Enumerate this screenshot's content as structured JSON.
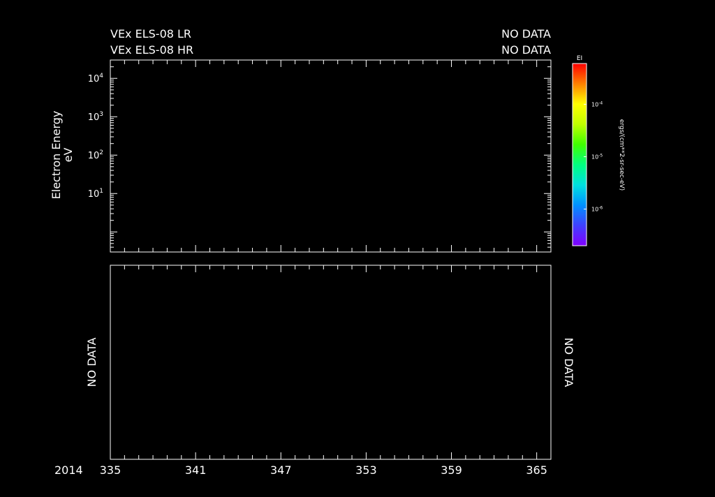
{
  "header": {
    "lr_label": "VEx ELS-08 LR",
    "hr_label": "VEx ELS-08 HR",
    "lr_status": "NO DATA",
    "hr_status": "NO DATA"
  },
  "top_panel": {
    "ylabel_line1": "Electron Energy",
    "ylabel_line2": "eV"
  },
  "bottom_panel": {
    "left_status": "NO DATA",
    "right_status": "NO DATA"
  },
  "colorbar": {
    "title": "EI",
    "label": "ergs/(cm**2-sr-sec-eV)",
    "ticks": [
      {
        "mantissa": "10",
        "exp": "-4",
        "value": 0.0001
      },
      {
        "mantissa": "10",
        "exp": "-5",
        "value": 1e-05
      },
      {
        "mantissa": "10",
        "exp": "-6",
        "value": 1e-06
      }
    ],
    "colors": [
      "#8000ff",
      "#4040ff",
      "#0090ff",
      "#00e0e0",
      "#00ff80",
      "#40ff00",
      "#c0ff00",
      "#ffff00",
      "#ff8000",
      "#ff0000"
    ]
  },
  "chart_data": [
    {
      "type": "heatmap",
      "title": "VEx ELS-08 LR / VEx ELS-08 HR",
      "status": "NO DATA",
      "xlabel": "",
      "ylabel": "Electron Energy eV",
      "yscale": "log",
      "ylim": [
        0.3,
        30000
      ],
      "yticks": [
        {
          "mantissa": "10",
          "exp": "4",
          "value": 10000
        },
        {
          "mantissa": "10",
          "exp": "3",
          "value": 1000
        },
        {
          "mantissa": "10",
          "exp": "2",
          "value": 100
        },
        {
          "mantissa": "10",
          "exp": "1",
          "value": 10
        }
      ],
      "xlim": [
        335,
        366
      ],
      "values": []
    },
    {
      "type": "line",
      "status": "NO DATA",
      "xlabel": "2014",
      "xlim": [
        335,
        366
      ],
      "xticks": [
        "335",
        "341",
        "347",
        "353",
        "359",
        "365"
      ],
      "xtick_values": [
        335,
        341,
        347,
        353,
        359,
        365
      ],
      "series": []
    }
  ]
}
